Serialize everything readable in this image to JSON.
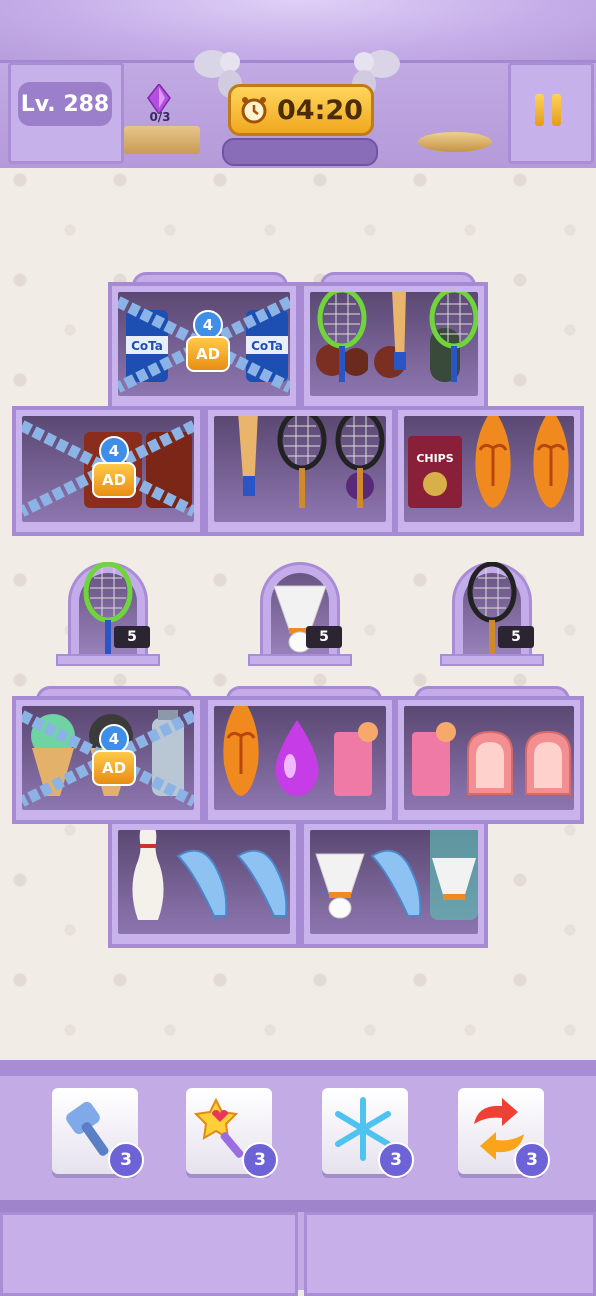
{
  "hud": {
    "level": "Lv. 288",
    "gem_progress": "0/3",
    "timer": "04:20"
  },
  "shelves": {
    "lock_top_left": {
      "count": "4",
      "ad": "AD"
    },
    "lock_mid_left": {
      "count": "4",
      "ad": "AD"
    },
    "lock_low_left": {
      "count": "4",
      "ad": "AD"
    }
  },
  "niches": [
    {
      "count": "5"
    },
    {
      "count": "5"
    },
    {
      "count": "5"
    }
  ],
  "labels": {
    "cola": "CoTa",
    "chips": "CHIPS"
  },
  "boosters": [
    {
      "name": "hammer",
      "count": "3"
    },
    {
      "name": "magic-wand",
      "count": "3"
    },
    {
      "name": "freeze",
      "count": "3"
    },
    {
      "name": "shuffle",
      "count": "3"
    }
  ],
  "colors": {
    "frame": "#c9b3ec",
    "frame_border": "#a68bd4",
    "timer": "#ffd55c",
    "lock_badge": "#3f8ee8"
  }
}
